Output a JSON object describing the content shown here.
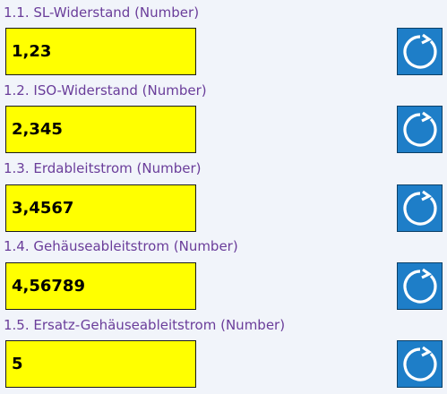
{
  "fields": [
    {
      "label": "1.1. SL-Widerstand (Number)",
      "value": "1,23",
      "reset_icon": "refresh-icon"
    },
    {
      "label": "1.2. ISO-Widerstand (Number)",
      "value": "2,345",
      "reset_icon": "refresh-icon"
    },
    {
      "label": "1.3. Erdableitstrom (Number)",
      "value": "3,4567",
      "reset_icon": "refresh-icon"
    },
    {
      "label": "1.4. Gehäuseableitstrom (Number)",
      "value": "4,56789",
      "reset_icon": "refresh-icon"
    },
    {
      "label": "1.5. Ersatz-Gehäuseableitstrom (Number)",
      "value": "5",
      "reset_icon": "refresh-icon"
    }
  ],
  "colors": {
    "label": "#6a3d9a",
    "input_background": "#ffff00",
    "reset_button": "#1e7ec8",
    "page_background": "#f1f4fa"
  }
}
